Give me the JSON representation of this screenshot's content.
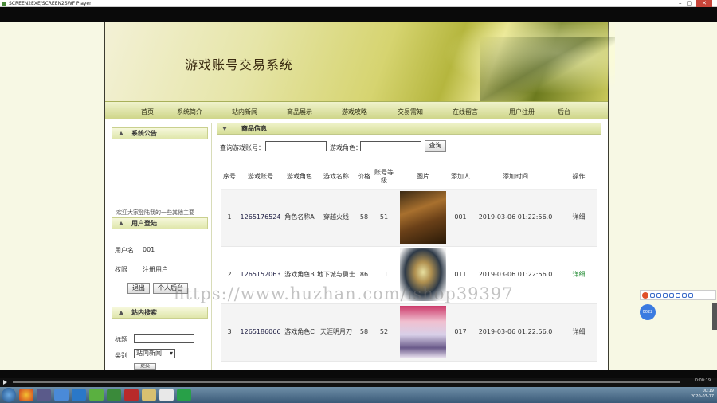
{
  "window": {
    "title": "SCREEN2EXE/SCREEN2SWF Player",
    "min": "–",
    "max": "▢",
    "close": "✕"
  },
  "site": {
    "title": "游戏账号交易系统"
  },
  "nav": [
    "首页",
    "系统简介",
    "站内新闻",
    "商品展示",
    "游戏攻略",
    "交易需知",
    "在线留言",
    "用户注册",
    "后台"
  ],
  "sidebar": {
    "notice_title": "系统公告",
    "notice_scroll": "欢迎大家登陆我的一些其他主要",
    "login_title": "用户登陆",
    "username_label": "用户名",
    "username_value": "001",
    "role_label": "权限",
    "role_value": "注册用户",
    "logout_label": "退出",
    "profile_label": "个人后台",
    "search_title": "站内搜索",
    "search_title_label": "标题",
    "search_category_label": "类别",
    "search_category_value": "站内新闻",
    "search_button": "提交"
  },
  "goods": {
    "panel_title": "商品信息",
    "query_label": "查询",
    "account_label": "游戏账号：",
    "role_label": "游戏角色：",
    "query_button": "查询",
    "columns": [
      "序号",
      "游戏账号",
      "游戏角色",
      "游戏名称",
      "价格",
      "账号等级",
      "图片",
      "添加人",
      "添加时间",
      "操作"
    ],
    "rows": [
      {
        "no": "1",
        "account": "1265176524",
        "role": "角色名称A",
        "game": "穿越火线",
        "price": "58",
        "level": "51",
        "adder": "001",
        "time": "2019-03-06 01:22:56.0",
        "action": "详细"
      },
      {
        "no": "2",
        "account": "1265152063",
        "role": "游戏角色B",
        "game": "地下城与勇士",
        "price": "86",
        "level": "11",
        "adder": "011",
        "time": "2019-03-06 01:22:56.0",
        "action": "详细"
      },
      {
        "no": "3",
        "account": "1265186066",
        "role": "游戏角色C",
        "game": "天涯明月刀",
        "price": "58",
        "level": "52",
        "adder": "017",
        "time": "2019-03-06 01:22:56.0",
        "action": "详细"
      }
    ]
  },
  "watermark": "https://www.huzhan.com/ishop39397",
  "player": {
    "time": "0:00:19"
  },
  "tray": {
    "time": "00:19",
    "date": "2020-03-17"
  },
  "ime": {
    "badge": "0022"
  }
}
